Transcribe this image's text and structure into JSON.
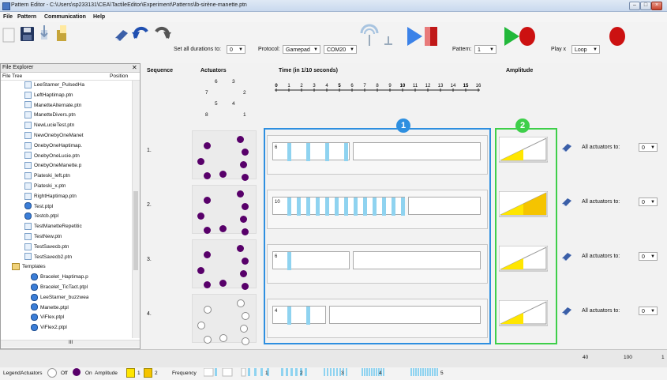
{
  "window": {
    "title": "Pattern Editor - C:\\Users\\sp233131\\CEA\\TactileEditor\\Experiment\\Patterns\\lb-sirène-manette.ptn"
  },
  "menu": [
    "File",
    "Pattern",
    "Communication",
    "Help"
  ],
  "toolbar": {
    "set_all_durations_label": "Set all durations to:",
    "set_all_durations_value": "0",
    "protocol_label": "Protocol:",
    "protocol_value": "Gamepad",
    "port_value": "COM20",
    "pattern_label": "Pattern:",
    "pattern_value": "1",
    "play_label": "Play x",
    "play_value": "Loop"
  },
  "explorer": {
    "title": "File Explorer",
    "col_tree": "File Tree",
    "col_position": "Position",
    "items": [
      {
        "label": "LeeStarner_PulsedHa",
        "type": "file"
      },
      {
        "label": "LeftHaptimap.ptn",
        "type": "file"
      },
      {
        "label": "ManetteAlternate.ptn",
        "type": "file"
      },
      {
        "label": "ManetteDivers.ptn",
        "type": "file"
      },
      {
        "label": "NewLucieTest.ptn",
        "type": "file"
      },
      {
        "label": "NewOnebyOneManet",
        "type": "file"
      },
      {
        "label": "OnebyOneHaptimap.",
        "type": "file"
      },
      {
        "label": "OnebyOneLucie.ptn",
        "type": "file"
      },
      {
        "label": "OnebyOneManette.p",
        "type": "file"
      },
      {
        "label": "Piateski_left.ptn",
        "type": "file"
      },
      {
        "label": "Piateski_x.ptn",
        "type": "file"
      },
      {
        "label": "RightHaptimap.ptn",
        "type": "file"
      },
      {
        "label": "Test.ptpl",
        "type": "ptpl"
      },
      {
        "label": "Testcb.ptpl",
        "type": "ptpl"
      },
      {
        "label": "TestManetteRepetitic",
        "type": "file"
      },
      {
        "label": "TestNew.ptn",
        "type": "file"
      },
      {
        "label": "TestSavecb.ptn",
        "type": "file"
      },
      {
        "label": "TestSavecb2.ptn",
        "type": "file"
      },
      {
        "label": "Templates",
        "type": "folder"
      },
      {
        "label": "Bracelet_Haptimap.p",
        "type": "ptpl"
      },
      {
        "label": "Bracelet_TicTact.ptpl",
        "type": "ptpl"
      },
      {
        "label": "LeeStarner_buzzwea",
        "type": "ptpl"
      },
      {
        "label": "Manette.ptpl",
        "type": "ptpl"
      },
      {
        "label": "ViFlex.ptpl",
        "type": "ptpl"
      },
      {
        "label": "ViFlex2.ptpl",
        "type": "ptpl"
      }
    ],
    "scroll_marker": "III"
  },
  "columns": {
    "sequence": "Sequence",
    "actuators": "Actuators",
    "time": "Time (in 1/10 seconds)",
    "amplitude": "Amplitude"
  },
  "actuator_map_labels": [
    "6",
    "3",
    "7",
    "2",
    "5",
    "4",
    "8",
    "1"
  ],
  "time_ticks": [
    "0",
    "1",
    "2",
    "3",
    "4",
    "5",
    "6",
    "7",
    "8",
    "9",
    "10",
    "11",
    "12",
    "13",
    "14",
    "15",
    "16"
  ],
  "badges": {
    "time": "1",
    "amplitude": "2"
  },
  "rows": [
    {
      "seq": "1.",
      "duration": "6",
      "stripes": 4,
      "amplitude": 1,
      "all_label": "All actuators to:",
      "all_value": "0"
    },
    {
      "seq": "2.",
      "duration": "10",
      "stripes": 13,
      "amplitude": 2,
      "all_label": "All actuators to:",
      "all_value": "0"
    },
    {
      "seq": "3.",
      "duration": "6",
      "stripes": 1,
      "amplitude": 1,
      "all_label": "All actuators to:",
      "all_value": "0"
    },
    {
      "seq": "4.",
      "duration": "4",
      "stripes": 2,
      "amplitude": 1,
      "all_label": "All actuators to:",
      "all_value": "0"
    }
  ],
  "status": {
    "v1": "40",
    "v2": "100",
    "v3": "1"
  },
  "legend": {
    "legend_label": "Legend:",
    "actuators_label": "Actuators",
    "off_label": "Off",
    "on_label": "On",
    "amplitude_label": "Amplitude",
    "amp1": "1",
    "amp2": "2",
    "frequency_label": "Frequency",
    "f1": "1",
    "f2": "2",
    "f3": "3",
    "f4": "4",
    "f5": "5"
  },
  "colors": {
    "accent_blue": "#2e8fe0",
    "accent_green": "#3ecf4a",
    "actuator_on": "#58006a",
    "stripe": "#8fd3f0",
    "amp_yellow": "#ffe600",
    "amp_orange": "#f5c400"
  }
}
